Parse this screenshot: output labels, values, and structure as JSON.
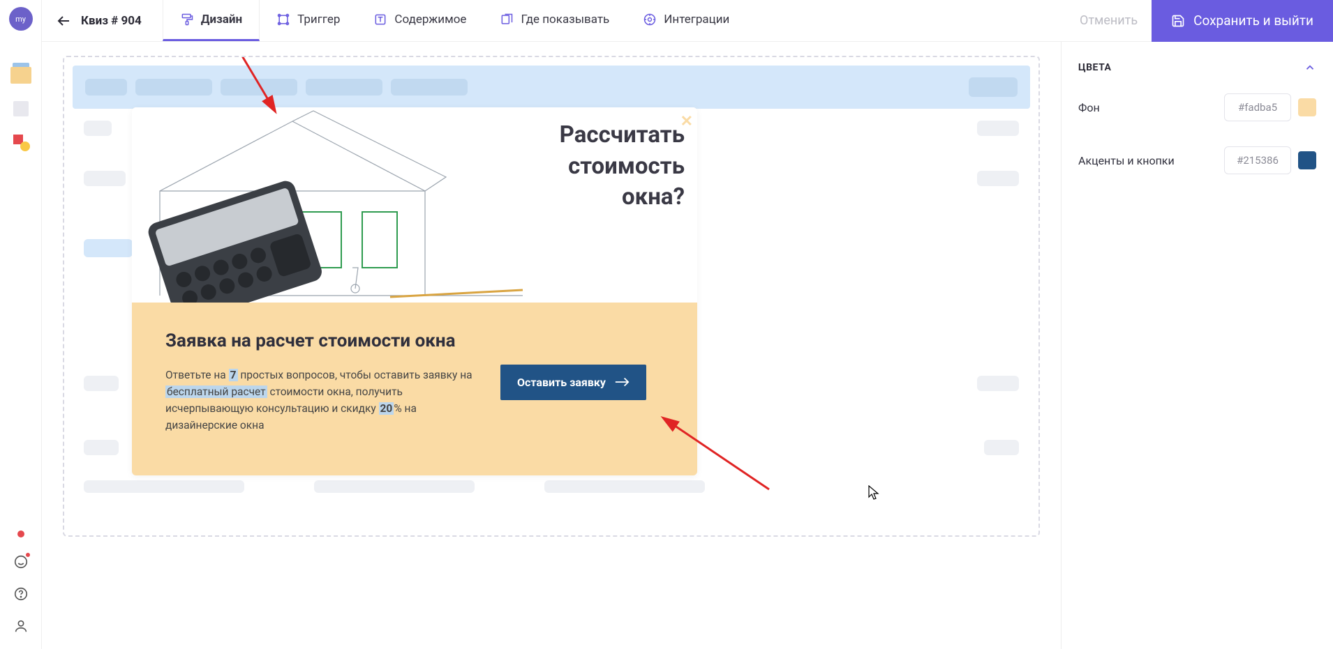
{
  "avatar_text": "my",
  "header": {
    "back_label": "Квиз # 904",
    "tabs": {
      "design": "Дизайн",
      "trigger": "Триггер",
      "content": "Содержимое",
      "where": "Где показывать",
      "integrations": "Интеграции"
    },
    "cancel": "Отменить",
    "save": "Сохранить и выйти"
  },
  "quiz": {
    "title_l1": "Рассчитать",
    "title_l2": "стоимость",
    "title_l3": "окна?",
    "close": "✕",
    "heading": "Заявка на расчет стоимости окна",
    "desc_p1": "Ответьте на ",
    "desc_num": "7",
    "desc_p2": " простых вопросов, чтобы оставить заявку на ",
    "desc_hl": "бесплатный расчет",
    "desc_p3": " стоимости окна, получить исчерпывающую консультацию и скидку ",
    "desc_pct": "20",
    "desc_p4": "% на дизайнерские окна",
    "cta": "Оставить заявку"
  },
  "panel": {
    "section": "ЦВЕТА",
    "bg_label": "Фон",
    "bg_value": "#fadba5",
    "accent_label": "Акценты и кнопки",
    "accent_value": "#215386"
  }
}
